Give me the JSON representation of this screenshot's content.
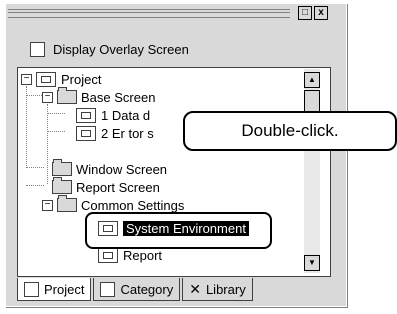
{
  "window": {
    "min_label": "□",
    "close_label": "x"
  },
  "options": {
    "display_overlay_label": "Display Overlay Screen",
    "display_overlay_checked": false
  },
  "tree": {
    "project": "Project",
    "base_screen": "Base Screen",
    "item1": "1 Data d",
    "item2": "2 Er tor s",
    "window_screen": "Window Screen",
    "report_screen": "Report Screen",
    "common_settings": "Common Settings",
    "system_environment": "System Environment",
    "report": "Report"
  },
  "callout": {
    "text": "Double-click."
  },
  "tabs": [
    {
      "label": "Project",
      "icon": "project-icon"
    },
    {
      "label": "Category",
      "icon": "category-icon"
    },
    {
      "label": "Library",
      "icon": "library-icon"
    }
  ],
  "scrollbar": {
    "up_label": "▲",
    "down_label": "▼"
  }
}
